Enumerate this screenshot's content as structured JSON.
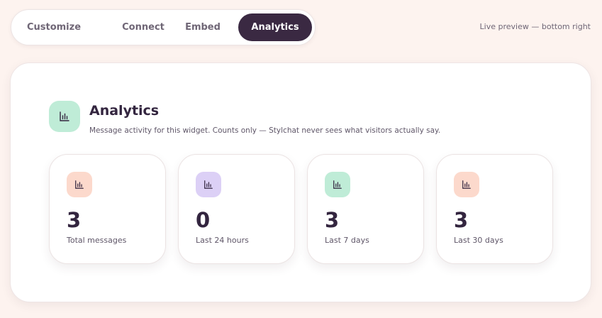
{
  "tabs": [
    {
      "label": "Customize",
      "active": false
    },
    {
      "label": "Connect",
      "active": false
    },
    {
      "label": "Embed",
      "active": false
    },
    {
      "label": "Analytics",
      "active": true
    }
  ],
  "preview_note": "Live preview — bottom right",
  "panel": {
    "icon": "bar-chart-icon",
    "title": "Analytics",
    "subtitle": "Message activity for this widget. Counts only — Stylchat never sees what visitors actually say."
  },
  "stats": [
    {
      "value": "3",
      "label": "Total messages",
      "icon": "bar-chart-icon",
      "icon_bg": "#fcd9cc"
    },
    {
      "value": "0",
      "label": "Last 24 hours",
      "icon": "bar-chart-icon",
      "icon_bg": "#dcd0f6"
    },
    {
      "value": "3",
      "label": "Last 7 days",
      "icon": "bar-chart-icon",
      "icon_bg": "#bfecd7"
    },
    {
      "value": "3",
      "label": "Last 30 days",
      "icon": "bar-chart-icon",
      "icon_bg": "#fcd9cc"
    }
  ],
  "colors": {
    "background": "#fdf3ef",
    "active_tab": "#3a2942",
    "text": "#33253f",
    "header_icon_bg": "#bfecd7"
  }
}
